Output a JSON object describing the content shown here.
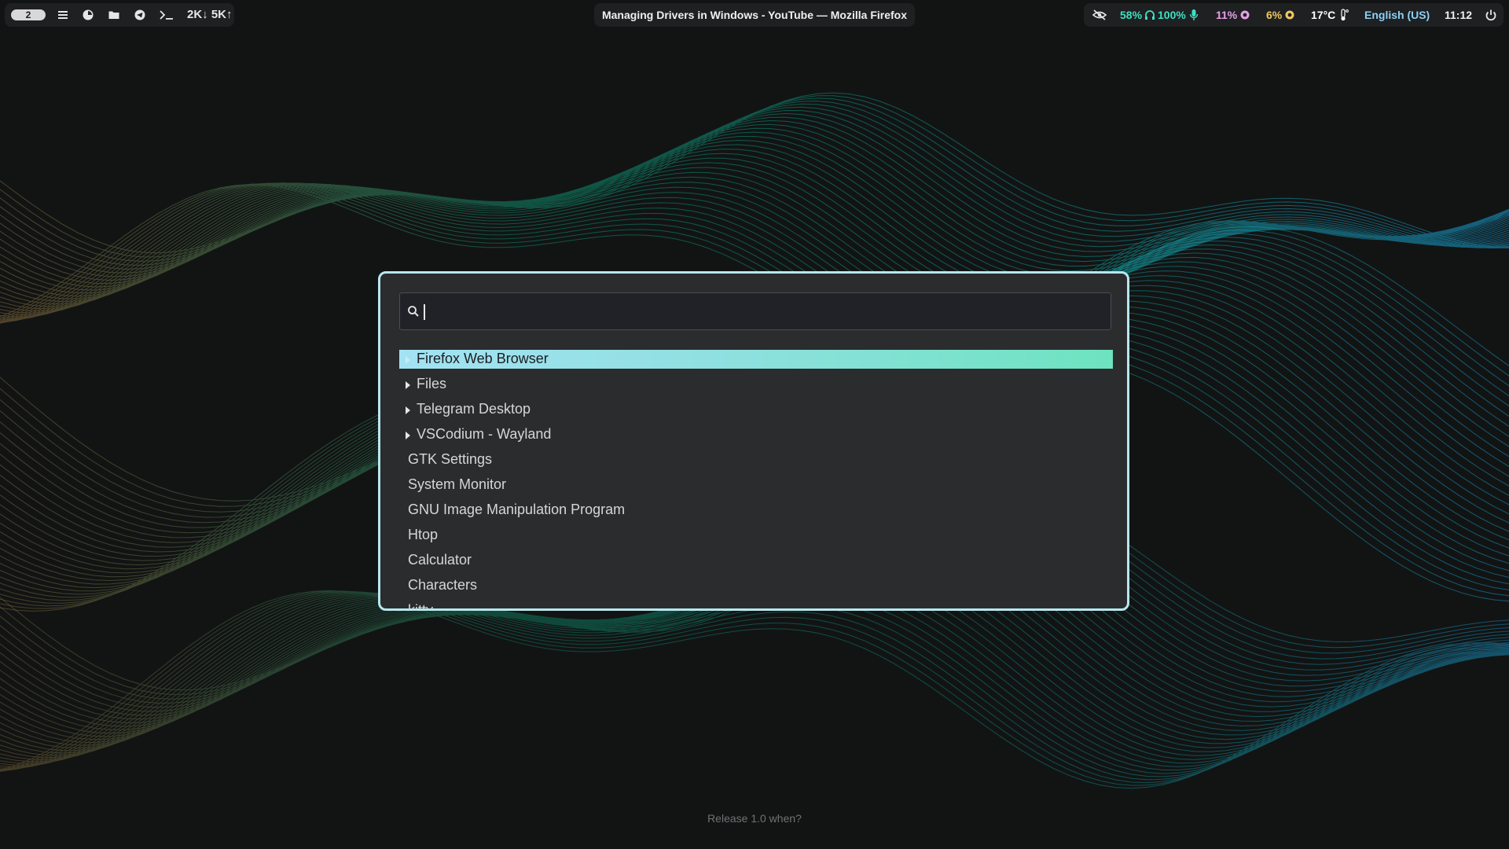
{
  "topbar": {
    "workspace": "2",
    "network_speed": "2K↓ 5K↑",
    "window_title": "Managing Drivers in Windows - YouTube — Mozilla Firefox",
    "volume": "58%",
    "headphone_volume": "100%",
    "cpu": "11%",
    "memory": "6%",
    "temperature": "17°C",
    "keyboard_layout": "English (US)",
    "clock": "11:12",
    "icons": {
      "menu": "hamburger-menu-icon",
      "firefox": "firefox-icon",
      "files": "folder-icon",
      "telegram": "telegram-icon",
      "terminal": "terminal-icon",
      "privacy": "eye-off-icon",
      "headphones": "headphones-icon",
      "mic": "microphone-icon",
      "cpu": "cpu-icon",
      "memory": "memory-icon",
      "thermometer": "thermometer-icon",
      "power": "power-icon"
    },
    "colors": {
      "volume": "#3ee0c1",
      "cpu": "#e6a0e6",
      "memory": "#f0c860",
      "temperature": "#ffffff",
      "keyboard": "#8fd0f5"
    }
  },
  "launcher": {
    "search": {
      "value": "",
      "placeholder": ""
    },
    "selected_index": 0,
    "items": [
      {
        "label": "Firefox Web Browser",
        "expandable": true
      },
      {
        "label": "Files",
        "expandable": true
      },
      {
        "label": "Telegram Desktop",
        "expandable": true
      },
      {
        "label": "VSCodium - Wayland",
        "expandable": true
      },
      {
        "label": "GTK Settings",
        "expandable": false
      },
      {
        "label": "System Monitor",
        "expandable": false
      },
      {
        "label": "GNU Image Manipulation Program",
        "expandable": false
      },
      {
        "label": "Htop",
        "expandable": false
      },
      {
        "label": "Calculator",
        "expandable": false
      },
      {
        "label": "Characters",
        "expandable": false
      },
      {
        "label": "kitty",
        "expandable": false
      }
    ],
    "colors": {
      "border": "#b7e7ee",
      "selected_gradient_start": "#a3e2f3",
      "selected_gradient_end": "#6ee3c0"
    }
  },
  "footer": {
    "text": "Release 1.0 when?"
  }
}
